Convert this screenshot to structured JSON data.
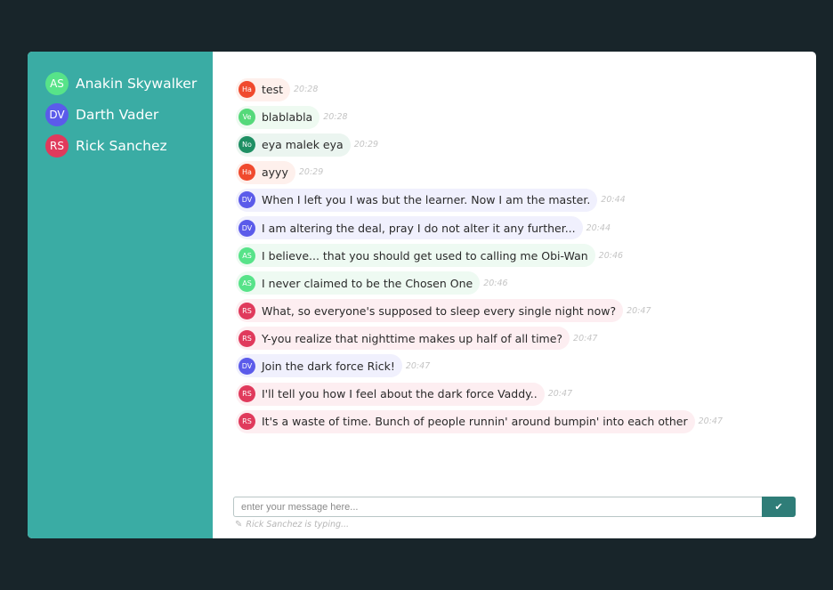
{
  "colors": {
    "background": "#18252a",
    "sidebar": "#3aaca4",
    "send_button": "#2f7d78"
  },
  "sidebar": {
    "users": [
      {
        "initials": "AS",
        "name": "Anakin Skywalker",
        "color": "#57e389",
        "bubble": "#eefaf2"
      },
      {
        "initials": "DV",
        "name": "Darth Vader",
        "color": "#5b5bea",
        "bubble": "#f0f0fd"
      },
      {
        "initials": "RS",
        "name": "Rick Sanchez",
        "color": "#e03a5c",
        "bubble": "#fdeef1"
      }
    ]
  },
  "messages": [
    {
      "initials": "Ha",
      "text": "test",
      "time": "20:28",
      "color": "#f04a2e",
      "bubble": "#fef0ec"
    },
    {
      "initials": "Ve",
      "text": "blablabla",
      "time": "20:28",
      "color": "#55d97a",
      "bubble": "#eefaf1"
    },
    {
      "initials": "No",
      "text": "eya malek eya",
      "time": "20:29",
      "color": "#1e8f63",
      "bubble": "#ebf5f0"
    },
    {
      "initials": "Ha",
      "text": "ayyy",
      "time": "20:29",
      "color": "#f04a2e",
      "bubble": "#fef0ec"
    },
    {
      "initials": "DV",
      "text": "When I left you I was but the learner. Now I am the master.",
      "time": "20:44",
      "color": "#5b5bea",
      "bubble": "#f0f0fd"
    },
    {
      "initials": "DV",
      "text": "I am altering the deal, pray I do not alter it any further...",
      "time": "20:44",
      "color": "#5b5bea",
      "bubble": "#f0f0fd"
    },
    {
      "initials": "AS",
      "text": "I believe... that you should get used to calling me Obi-Wan",
      "time": "20:46",
      "color": "#57e389",
      "bubble": "#eefaf2"
    },
    {
      "initials": "AS",
      "text": "I never claimed to be the Chosen One",
      "time": "20:46",
      "color": "#57e389",
      "bubble": "#eefaf2"
    },
    {
      "initials": "RS",
      "text": "What, so everyone's supposed to sleep every single night now?",
      "time": "20:47",
      "color": "#e03a5c",
      "bubble": "#fdeef1"
    },
    {
      "initials": "RS",
      "text": "Y-you realize that nighttime makes up half of all time?",
      "time": "20:47",
      "color": "#e03a5c",
      "bubble": "#fdeef1"
    },
    {
      "initials": "DV",
      "text": "Join the dark force Rick!",
      "time": "20:47",
      "color": "#5b5bea",
      "bubble": "#f0f0fd"
    },
    {
      "initials": "RS",
      "text": "I'll tell you how I feel about the dark force Vaddy..",
      "time": "20:47",
      "color": "#e03a5c",
      "bubble": "#fdeef1"
    },
    {
      "initials": "RS",
      "text": "It's a waste of time. Bunch of people runnin' around bumpin' into each other",
      "time": "20:47",
      "color": "#e03a5c",
      "bubble": "#fdeef1"
    }
  ],
  "composer": {
    "placeholder": "enter your message here...",
    "value": "",
    "send_icon": "check-icon",
    "send_glyph": "✔",
    "typing_icon": "pencil-icon",
    "typing_text": "Rick Sanchez is typing..."
  }
}
